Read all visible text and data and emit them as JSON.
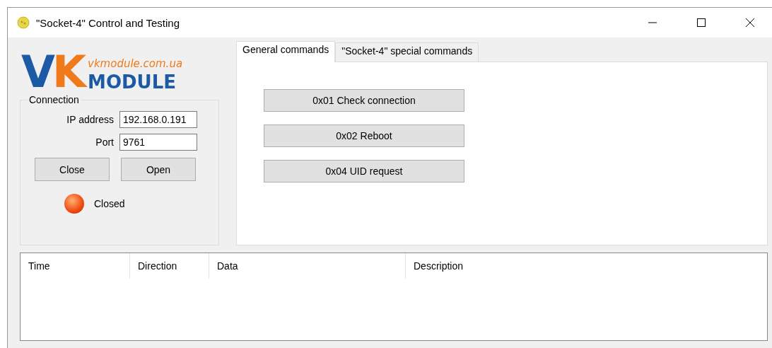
{
  "window": {
    "title": "\"Socket-4\" Control and Testing"
  },
  "logo": {
    "letters": [
      "V",
      "K"
    ],
    "word": "MODULE",
    "url": "vkmodule.com.ua"
  },
  "connection": {
    "title": "Connection",
    "fields": [
      {
        "label": "IP address",
        "value": "192.168.0.191"
      },
      {
        "label": "Port",
        "value": "9761"
      }
    ],
    "buttons": [
      "Close",
      "Open"
    ],
    "status": {
      "label": "Closed",
      "connected": false
    }
  },
  "tabs": [
    {
      "label": "General commands",
      "selected": true
    },
    {
      "label": "\"Socket-4\" special commands",
      "selected": false
    }
  ],
  "commands": [
    "0x01 Check connection",
    "0x02 Reboot",
    "0x04 UID request"
  ],
  "log": {
    "columns": [
      "Time",
      "Direction",
      "Data",
      "Description"
    ]
  }
}
